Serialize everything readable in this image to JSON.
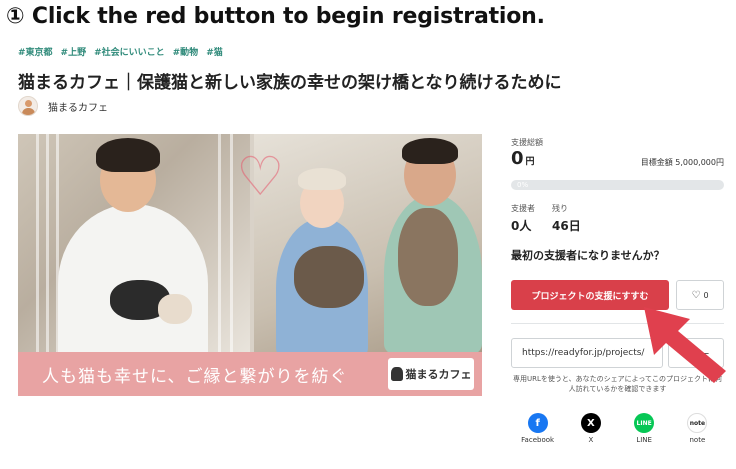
{
  "instruction": "① Click the red button to begin registration.",
  "tags": [
    "#東京都",
    "#上野",
    "#社会にいいこと",
    "#動物",
    "#猫"
  ],
  "project": {
    "title": "猫まるカフェ｜保護猫と新しい家族の幸せの架け橋となり続けるために",
    "owner": "猫まるカフェ"
  },
  "hero": {
    "banner_text": "人も猫も幸せに、ご縁と繋がりを紡ぐ",
    "logo_text": "猫まるカフェ"
  },
  "stats": {
    "total_label": "支援総額",
    "total_value": "0",
    "total_unit": "円",
    "goal_text": "目標金額 5,000,000円",
    "progress_text": "0%",
    "progress_fraction": 0,
    "supporters_label": "支援者",
    "supporters_value": "0人",
    "remaining_label": "残り",
    "remaining_value": "46日"
  },
  "cta": {
    "question": "最初の支援者になりませんか？",
    "support_button": "プロジェクトの支援にすすむ",
    "favorite_count": "0"
  },
  "share": {
    "url": "https://readyfor.jp/projects/",
    "copy_button": "コピー",
    "note": "専用URLを使うと、あなたのシェアによってこのプロジェクトに何人訪れているかを確認できます",
    "items": [
      {
        "label": "Facebook",
        "icon": "facebook-icon",
        "color": "#1877f2"
      },
      {
        "label": "X",
        "icon": "x-icon",
        "color": "#000000"
      },
      {
        "label": "LINE",
        "icon": "line-icon",
        "color": "#06c755"
      },
      {
        "label": "note",
        "icon": "note-icon",
        "color": "#ffffff"
      }
    ]
  },
  "colors": {
    "accent_red": "#d9404a",
    "tag_green": "#2f8a7a",
    "banner_pink": "#e8a3a3",
    "arrow_red": "#e0404e"
  }
}
